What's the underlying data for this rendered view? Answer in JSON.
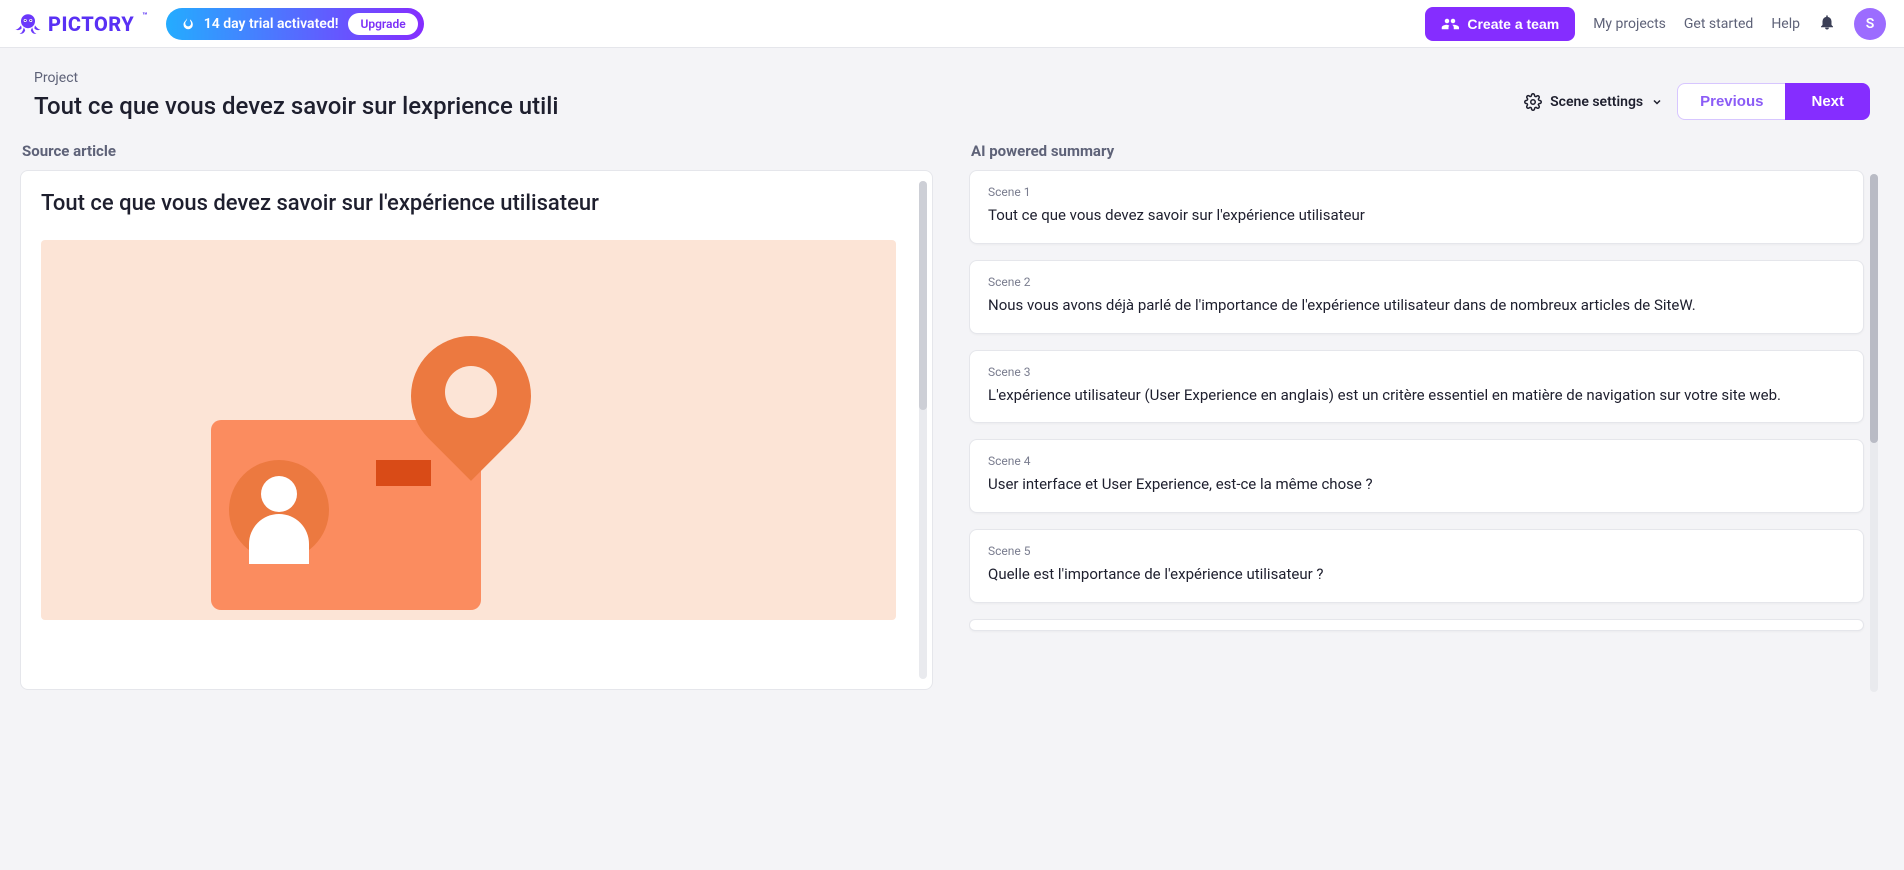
{
  "header": {
    "brand": "PICTORY",
    "trial_text": "14 day trial activated!",
    "upgrade_label": "Upgrade",
    "create_team_label": "Create a team",
    "nav_my_projects": "My projects",
    "nav_get_started": "Get started",
    "nav_help": "Help",
    "avatar_initial": "S"
  },
  "project": {
    "label": "Project",
    "title": "Tout ce que vous devez savoir sur lexprience utili",
    "scene_settings_label": "Scene settings",
    "prev_label": "Previous",
    "next_label": "Next"
  },
  "source": {
    "heading": "Source article",
    "title": "Tout ce que vous devez savoir sur l'expérience utilisateur"
  },
  "summary": {
    "heading": "AI powered summary",
    "scenes": [
      {
        "label": "Scene 1",
        "text": "Tout ce que vous devez savoir sur l'expérience utilisateur"
      },
      {
        "label": "Scene 2",
        "text": "Nous vous avons déjà parlé de l'importance de l'expérience utilisateur dans de nombreux articles de SiteW."
      },
      {
        "label": "Scene 3",
        "text": "L'expérience utilisateur (User Experience en anglais) est un critère essentiel en matière de navigation sur votre site web."
      },
      {
        "label": "Scene 4",
        "text": "User interface et User Experience, est-ce la même chose ?"
      },
      {
        "label": "Scene 5",
        "text": "Quelle est l'importance de l'expérience utilisateur ?"
      }
    ]
  }
}
